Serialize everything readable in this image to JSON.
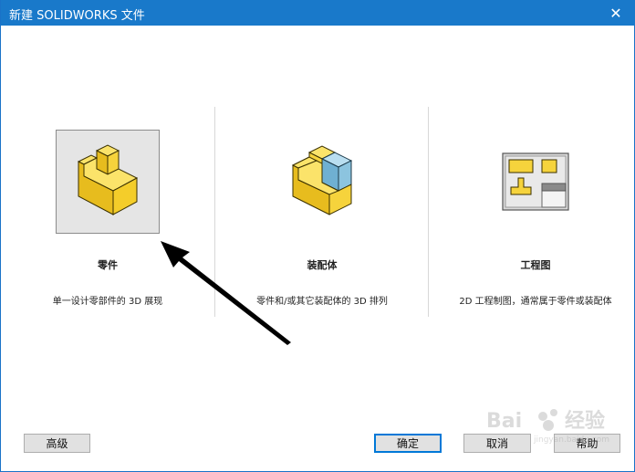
{
  "window": {
    "title": "新建 SOLIDWORKS 文件",
    "close_glyph": "✕"
  },
  "options": [
    {
      "label": "零件",
      "description": "单一设计零部件的 3D 展现",
      "icon": "part-icon",
      "selected": true
    },
    {
      "label": "装配体",
      "description": "零件和/或其它装配体的 3D 排列",
      "icon": "assembly-icon",
      "selected": false
    },
    {
      "label": "工程图",
      "description": "2D 工程制图，通常属于零件或装配体",
      "icon": "drawing-icon",
      "selected": false
    }
  ],
  "buttons": {
    "advanced": "高级",
    "ok": "确定",
    "cancel": "取消",
    "help": "帮助"
  },
  "watermark": {
    "logo_text": "Bai",
    "text": "经验",
    "sub": "jingyan.baidu.com"
  },
  "colors": {
    "titlebar": "#1979ca",
    "part_yellow": "#f6d33c",
    "assembly_blue": "#8cc4df",
    "selected_bg": "#e5e5e5"
  }
}
